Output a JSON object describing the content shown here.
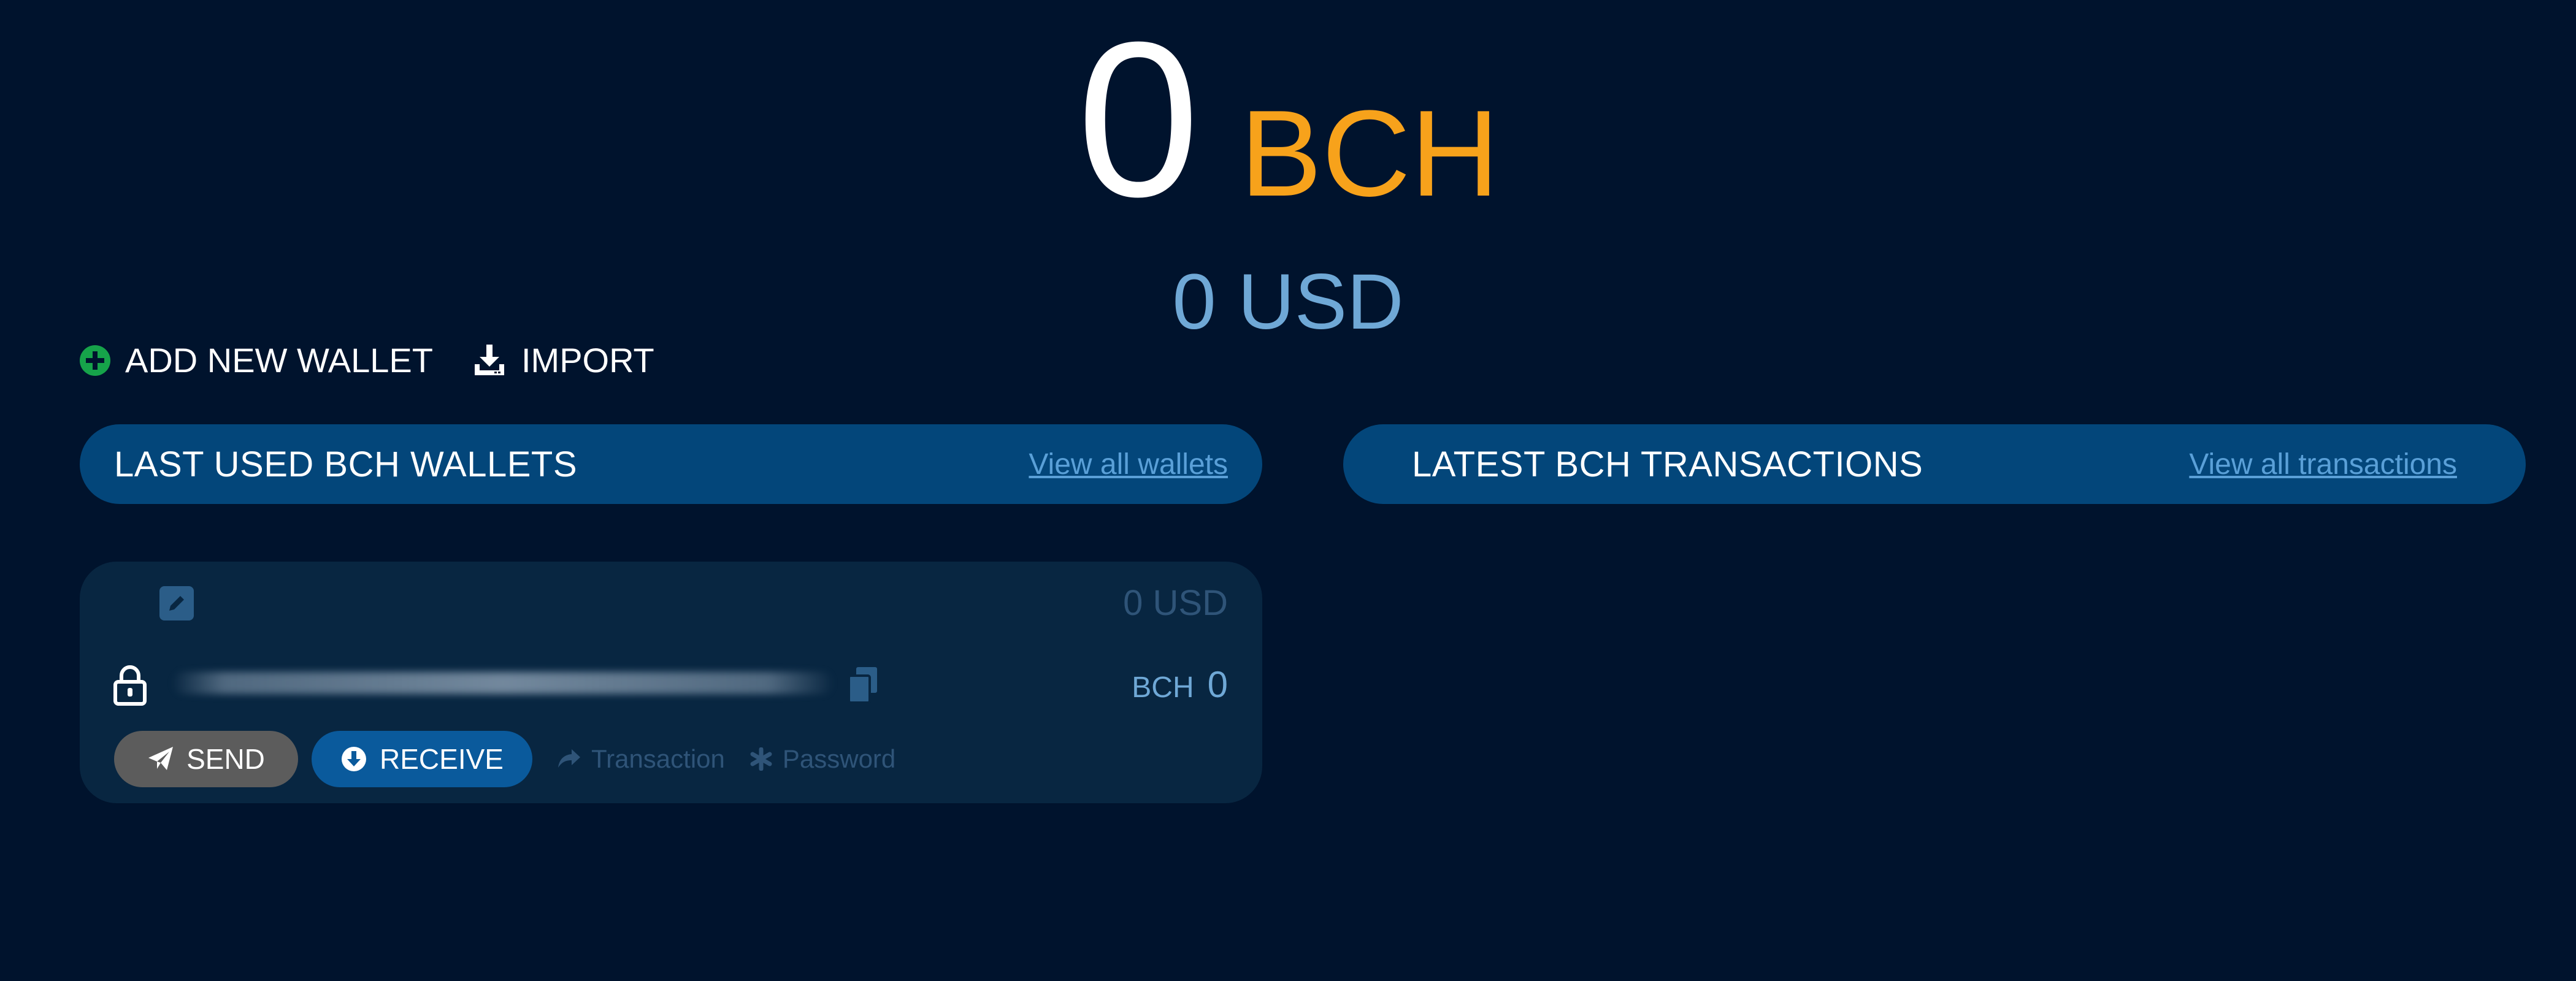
{
  "balance": {
    "amount": "0",
    "currency": "BCH",
    "fiat": "0 USD"
  },
  "actions": {
    "add_wallet": "ADD NEW WALLET",
    "import": "IMPORT"
  },
  "wallets_section": {
    "title": "LAST USED BCH WALLETS",
    "link": "View all wallets"
  },
  "transactions_section": {
    "title": "LATEST BCH TRANSACTIONS",
    "link": "View all transactions"
  },
  "wallet_card": {
    "fiat": "0 USD",
    "address": "",
    "bch_unit": "BCH",
    "bch_value": "0",
    "send_label": "SEND",
    "receive_label": "RECEIVE",
    "transaction_label": "Transaction",
    "password_label": "Password"
  },
  "colors": {
    "background": "#00132d",
    "accent_orange": "#f7a21b",
    "header_blue": "#03467a",
    "link_blue": "#5aa0d8",
    "card_bg": "#082641",
    "send_grey": "#5c5c5c",
    "receive_blue": "#0a5a9c",
    "add_green": "#16a34a"
  },
  "icons": {
    "add": "plus-circle-icon",
    "import": "download-icon",
    "edit": "edit-icon",
    "lock": "lock-icon",
    "copy": "copy-icon",
    "send": "paper-plane-icon",
    "receive": "arrow-down-circle-icon",
    "transaction": "share-arrow-icon",
    "password": "asterisk-icon"
  }
}
